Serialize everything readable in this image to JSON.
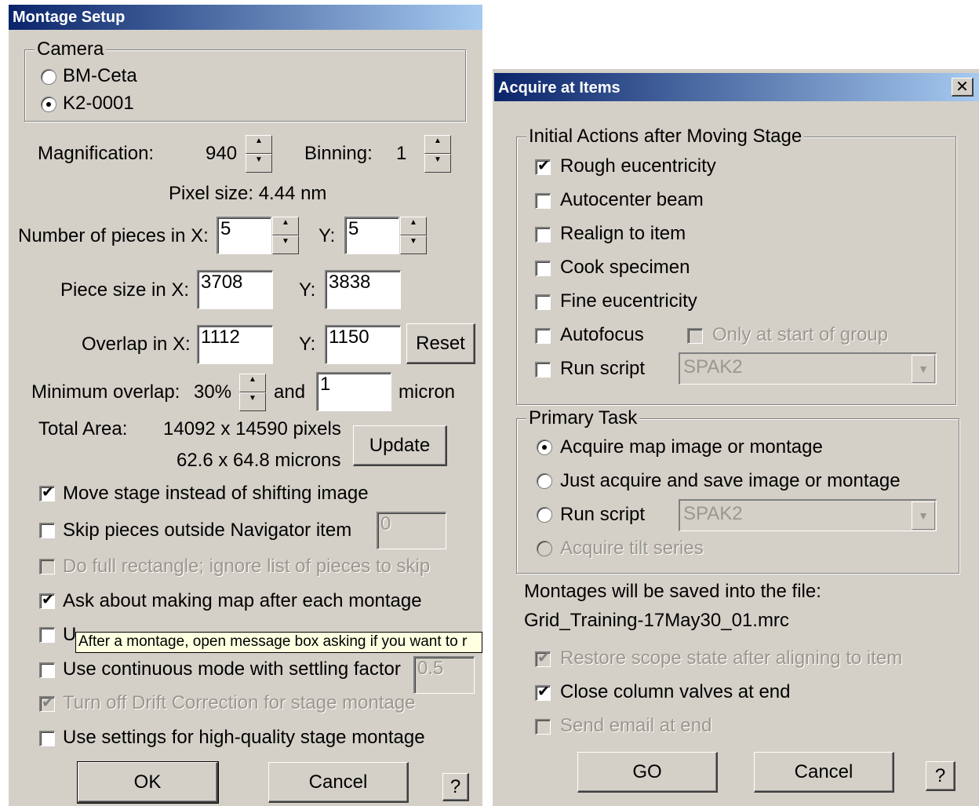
{
  "montage": {
    "title": "Montage Setup",
    "camera_group": "Camera",
    "cameras": [
      {
        "label": "BM-Ceta",
        "selected": false
      },
      {
        "label": "K2-0001",
        "selected": true
      }
    ],
    "magnification_label": "Magnification:",
    "magnification_value": "940",
    "binning_label": "Binning:",
    "binning_value": "1",
    "pixel_size": "Pixel size: 4.44 nm",
    "pieces_label": "Number of pieces in X:",
    "pieces_x": "5",
    "pieces_y_label": "Y:",
    "pieces_y": "5",
    "piece_size_label": "Piece size in X:",
    "piece_size_x": "3708",
    "piece_size_y_label": "Y:",
    "piece_size_y": "3838",
    "overlap_label": "Overlap in X:",
    "overlap_x": "1112",
    "overlap_y_label": "Y:",
    "overlap_y": "1150",
    "reset_button": "Reset",
    "min_overlap_label": "Minimum overlap:",
    "min_overlap_pct": "30%",
    "and_label": "and",
    "min_overlap_micron": "1",
    "micron_label": "micron",
    "total_area_label": "Total Area:",
    "total_pixels": "14092 x 14590 pixels",
    "total_microns": "62.6 x 64.8 microns",
    "update_button": "Update",
    "options": {
      "move_stage": "Move stage instead of shifting image",
      "skip_pieces": "Skip pieces outside Navigator item",
      "skip_value": "0",
      "full_rect": "Do full rectangle; ignore list of pieces to skip",
      "ask_map": "Ask about making map after each montage",
      "hidden_option": "U",
      "continuous": "Use continuous mode with settling factor",
      "continuous_value": "0.5",
      "drift": "Turn off Drift Correction for stage montage",
      "high_quality": "Use settings for high-quality stage montage"
    },
    "tooltip": "After a montage, open message box asking if you want to r",
    "ok_button": "OK",
    "cancel_button": "Cancel",
    "help_button": "?"
  },
  "acquire": {
    "title": "Acquire at Items",
    "close_glyph": "✕",
    "initial_group": "Initial Actions after Moving Stage",
    "initial_items": [
      {
        "label": "Rough eucentricity",
        "checked": true
      },
      {
        "label": "Autocenter beam",
        "checked": false
      },
      {
        "label": "Realign to item",
        "checked": false
      },
      {
        "label": "Cook specimen",
        "checked": false
      },
      {
        "label": "Fine eucentricity",
        "checked": false
      },
      {
        "label": "Autofocus",
        "checked": false
      },
      {
        "label": "Run script",
        "checked": false
      }
    ],
    "only_at_start": "Only at start of group",
    "script_select_1": "SPAK2",
    "primary_group": "Primary Task",
    "primary_items": [
      {
        "label": "Acquire map image or montage",
        "selected": true,
        "disabled": false
      },
      {
        "label": "Just acquire and save image or montage",
        "selected": false,
        "disabled": false
      },
      {
        "label": "Run script",
        "selected": false,
        "disabled": false
      },
      {
        "label": "Acquire tilt series",
        "selected": false,
        "disabled": true
      }
    ],
    "script_select_2": "SPAK2",
    "save_line": "Montages will be saved into the file:",
    "file_name": "Grid_Training-17May30_01.mrc",
    "restore_scope": "Restore scope state after aligning to item",
    "close_valves": "Close column valves at end",
    "send_email": "Send email at end",
    "go_button": "GO",
    "cancel_button": "Cancel",
    "help_button": "?"
  },
  "glyphs": {
    "check": "✔",
    "up": "▲",
    "down": "▼"
  }
}
